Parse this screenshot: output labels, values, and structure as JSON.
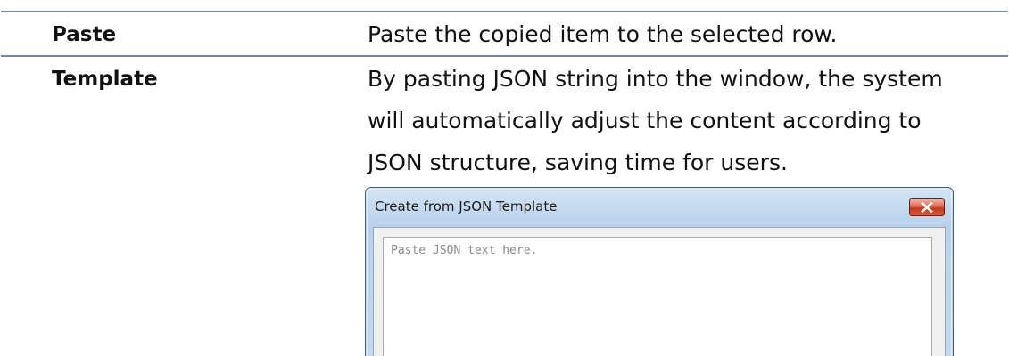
{
  "rows": [
    {
      "term": "Paste",
      "description_lines": [
        "Paste the copied item to the selected row."
      ]
    },
    {
      "term": "Template",
      "description_lines": [
        "By pasting JSON string into the window, the system",
        "will automatically adjust the content according to",
        "JSON structure, saving time for users."
      ]
    }
  ],
  "dialog": {
    "title": "Create from JSON Template",
    "textarea": {
      "value": "",
      "placeholder": "Paste JSON text here."
    }
  },
  "colors": {
    "rule": "#6f87a6",
    "dialog_border": "#3f5f7f",
    "close_button": "#c7381c"
  }
}
